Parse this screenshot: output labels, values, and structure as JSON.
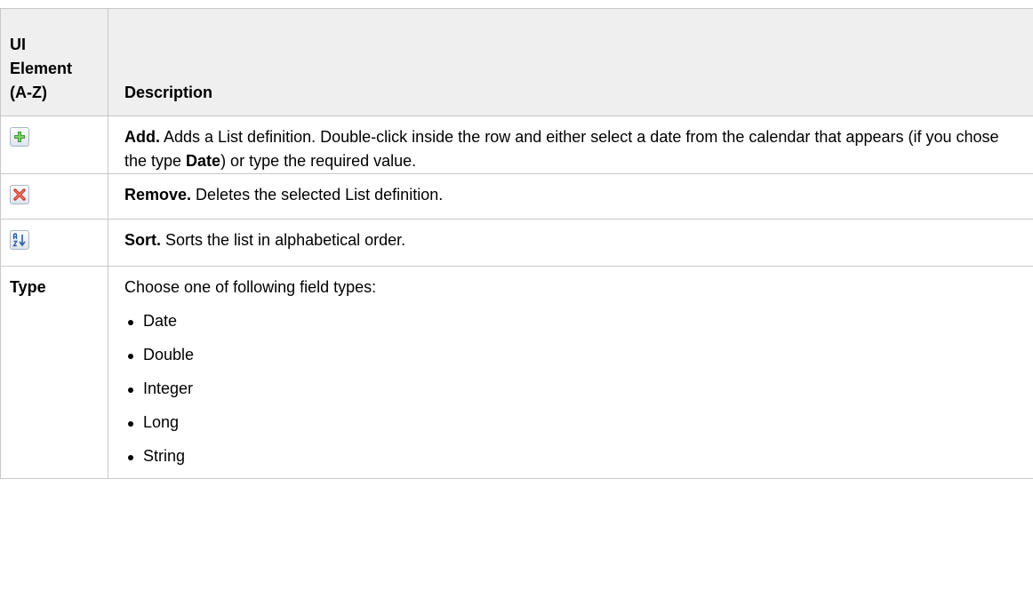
{
  "header": {
    "col1": "UI Element (A-Z)",
    "col1_lines": [
      "UI",
      "Element",
      "(A-Z)"
    ],
    "col2": "Description"
  },
  "rows": {
    "add": {
      "icon": "add-plus-icon",
      "title": "Add.",
      "text_before_bold": " Adds a List definition. Double-click inside the row and either select a date from the calendar that appears (if you chose the type ",
      "bold_word": "Date",
      "text_after_bold": ") or type the required value."
    },
    "remove": {
      "icon": "remove-x-icon",
      "title": "Remove.",
      "text": " Deletes the selected List definition."
    },
    "sort": {
      "icon": "sort-az-icon",
      "title": "Sort.",
      "text": " Sorts the list in alphabetical order."
    },
    "type": {
      "element": "Type",
      "intro": "Choose one of following field types:",
      "options": [
        "Date",
        "Double",
        "Integer",
        "Long",
        "String"
      ]
    }
  },
  "colors": {
    "header_bg": "#efefef",
    "border": "#c8c8c8",
    "add_icon_green": "#3c9a2e",
    "remove_icon_red": "#d23a2a",
    "sort_icon_blue": "#2b5fa8"
  }
}
